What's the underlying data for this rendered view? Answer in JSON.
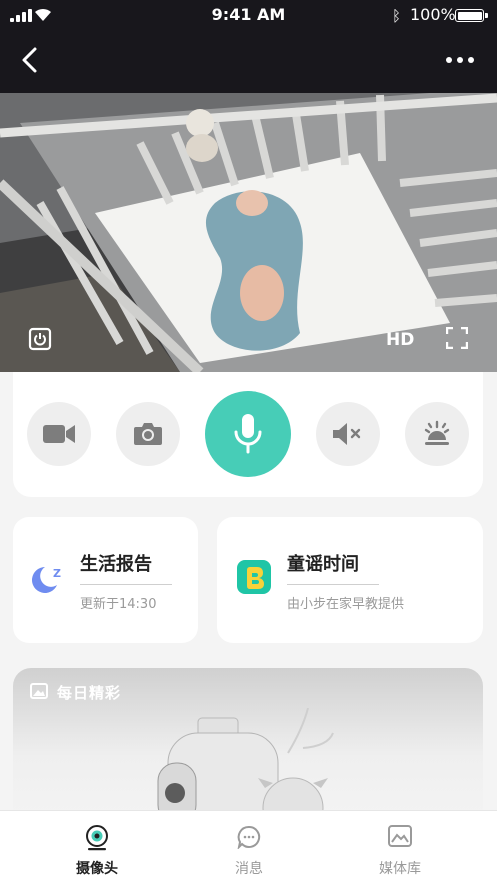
{
  "status_bar": {
    "time": "9:41 AM",
    "battery": "100%",
    "battery_level": 1.0
  },
  "video": {
    "quality": "HD"
  },
  "controls": {
    "items": [
      {
        "name": "record",
        "icon": "video-camera-icon"
      },
      {
        "name": "snapshot",
        "icon": "camera-icon"
      },
      {
        "name": "talk",
        "icon": "microphone-icon",
        "active": true,
        "color": "#47cdb7"
      },
      {
        "name": "mute",
        "icon": "speaker-mute-icon"
      },
      {
        "name": "brightness",
        "icon": "brightness-icon"
      }
    ]
  },
  "cards": {
    "life_report": {
      "title": "生活报告",
      "subtitle": "更新于14:30",
      "icon": "moon-sleep-icon",
      "icon_color": "#6f8cf0"
    },
    "nursery_rhymes": {
      "title": "童谣时间",
      "subtitle": "由小步在家早教提供",
      "icon": "footprint-app-icon",
      "icon_color": "#1fc5a6"
    }
  },
  "daily_highlight": {
    "title": "每日精彩"
  },
  "tabbar": {
    "tabs": [
      {
        "label": "摄像头",
        "icon": "camera-lens-icon",
        "active": true
      },
      {
        "label": "消息",
        "icon": "chat-bubble-icon",
        "active": false
      },
      {
        "label": "媒体库",
        "icon": "gallery-icon",
        "active": false
      }
    ]
  }
}
